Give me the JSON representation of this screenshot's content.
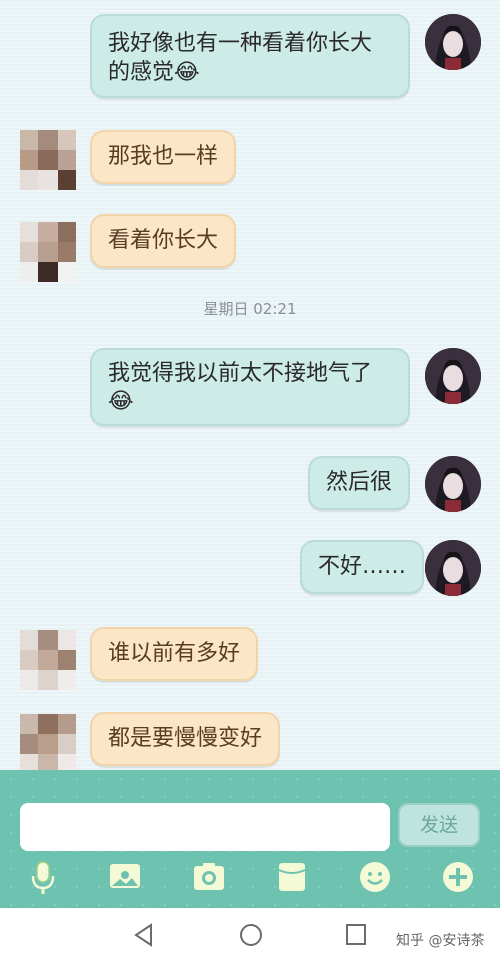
{
  "messages": [
    {
      "side": "me",
      "lines": [
        "我好像也有一种看着你长大",
        "的感觉😂"
      ]
    },
    {
      "side": "them",
      "text": "那我也一样"
    },
    {
      "side": "them",
      "text": "看着你长大"
    },
    {
      "side": "me",
      "lines": [
        "我觉得我以前太不接地气了",
        "😂"
      ]
    },
    {
      "side": "me",
      "text": "然后很"
    },
    {
      "side": "me",
      "text": "不好……"
    },
    {
      "side": "them",
      "text": "谁以前有多好"
    },
    {
      "side": "them",
      "text": "都是要慢慢变好"
    }
  ],
  "timestamp": "星期日 02:21",
  "input": {
    "value": "",
    "send_label": "发送"
  },
  "toolbar": [
    "microphone-icon",
    "image-icon",
    "camera-icon",
    "sticker-icon",
    "emoji-icon",
    "plus-icon"
  ],
  "navbar": [
    "back-icon",
    "home-icon",
    "recents-icon"
  ],
  "watermark": "知乎 @安诗茶",
  "colors": {
    "me_bubble": "#cdebe7",
    "them_bubble": "#fbe6c8",
    "input_bar": "#6ec2b0"
  }
}
